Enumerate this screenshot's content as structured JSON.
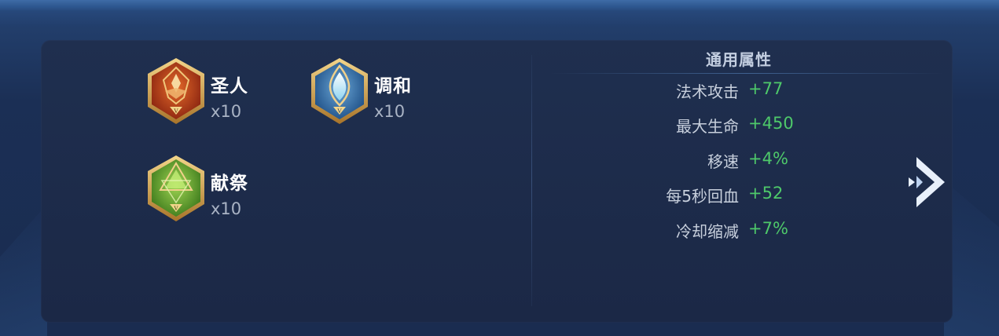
{
  "runes": [
    {
      "name": "圣人",
      "count": "x10",
      "icon": "saint-rune-icon",
      "color": "#c2421e"
    },
    {
      "name": "调和",
      "count": "x10",
      "icon": "harmony-rune-icon",
      "color": "#2d6fae"
    },
    {
      "name": "献祭",
      "count": "x10",
      "icon": "sacrifice-rune-icon",
      "color": "#5a9a2a"
    }
  ],
  "attributes": {
    "title": "通用属性",
    "rows": [
      {
        "label": "法术攻击",
        "value": "+77"
      },
      {
        "label": "最大生命",
        "value": "+450"
      },
      {
        "label": "移速",
        "value": "+4%"
      },
      {
        "label": "每5秒回血",
        "value": "+52"
      },
      {
        "label": "冷却缩减",
        "value": "+7%"
      }
    ]
  },
  "colors": {
    "value_green": "#4ec96a",
    "panel_bg": "#1f2f4f"
  },
  "next_icon": "chevron-right-icon"
}
